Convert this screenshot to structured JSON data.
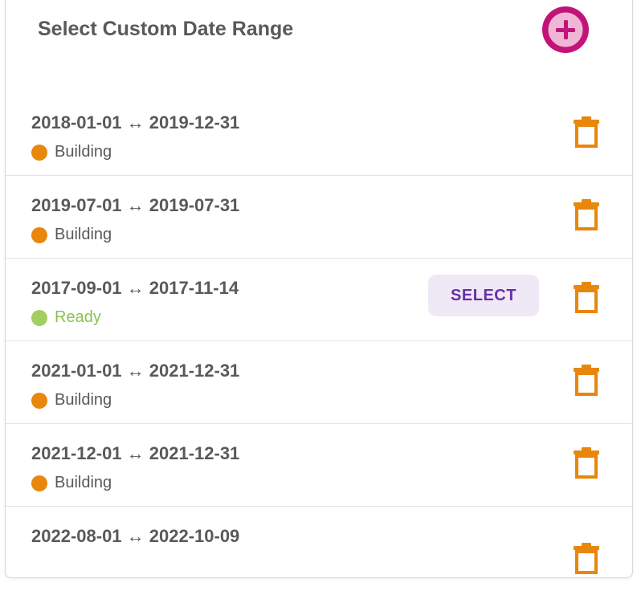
{
  "header": {
    "title": "Select Custom Date Range",
    "add_icon": "plus-circle-icon"
  },
  "colors": {
    "accent": "#c21478",
    "building": "#e8870c",
    "ready": "#a3cf62",
    "trash": "#e8870c",
    "select_bg": "#efe9f6",
    "select_text": "#6a2fa8"
  },
  "ranges": [
    {
      "label": "2018-01-01 ↔ 2019-12-31",
      "status": "Building"
    },
    {
      "label": "2019-07-01 ↔ 2019-07-31",
      "status": "Building"
    },
    {
      "label": "2017-09-01 ↔ 2017-11-14",
      "status": "Ready",
      "action": "SELECT"
    },
    {
      "label": "2021-01-01 ↔ 2021-12-31",
      "status": "Building"
    },
    {
      "label": "2021-12-01 ↔ 2021-12-31",
      "status": "Building"
    },
    {
      "label": "2022-08-01 ↔ 2022-10-09"
    }
  ],
  "delete_icon": "trash-icon"
}
